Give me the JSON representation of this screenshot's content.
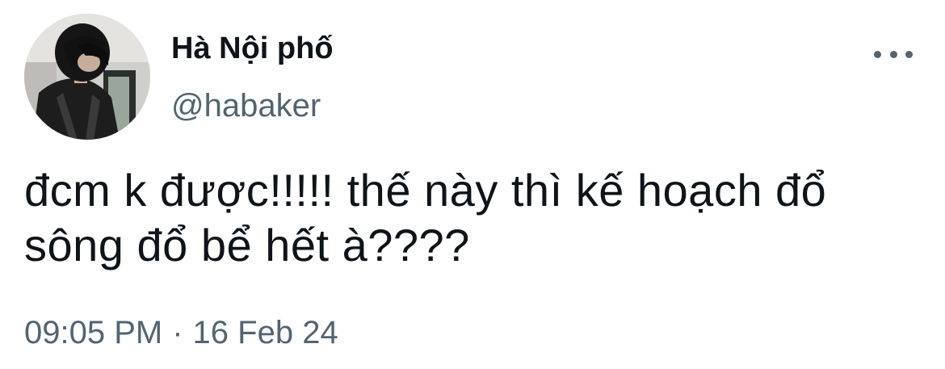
{
  "author": {
    "display_name": "Hà Nội phố",
    "handle": "@habaker",
    "avatar_icon": "user-avatar-photo"
  },
  "more_icon": "more-horizontal-icon",
  "tweet": {
    "text": "đcm k được!!!!! thế này thì kế hoạch đổ sông đổ bể hết à????"
  },
  "meta": {
    "time": "09:05 PM",
    "separator": "·",
    "date": "16 Feb 24"
  },
  "colors": {
    "text_primary": "#0f1419",
    "text_secondary": "#536471",
    "background": "#ffffff"
  }
}
